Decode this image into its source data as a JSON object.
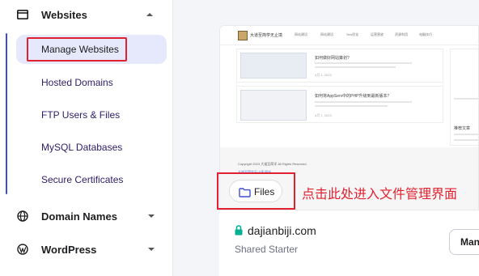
{
  "sidebar": {
    "websites_header": "Websites",
    "items": [
      {
        "label": "Manage Websites"
      },
      {
        "label": "Hosted Domains"
      },
      {
        "label": "FTP Users & Files"
      },
      {
        "label": "MySQL Databases"
      },
      {
        "label": "Secure Certificates"
      }
    ],
    "domain_names": "Domain Names",
    "wordpress": "WordPress"
  },
  "preview": {
    "site_name": "大道至简学无止境",
    "nav": [
      "网站建设",
      "网站建设",
      "Seo优化",
      "运营营收",
      "资源利用",
      "电脑技巧"
    ],
    "posts": [
      {
        "title": "如何做好网站策划?",
        "date": "4月 1, 2023"
      },
      {
        "title": "如何将AppServ中的PHP升级到最新版本？",
        "date": "4月 1, 2023"
      }
    ],
    "sidebar_heading": "推荐文章",
    "copyright": "Copyright 2023 大道至简学 All Rights Reserved.",
    "footer_link": "大道至简学无止境 网站"
  },
  "files_button": {
    "label": "Files"
  },
  "annotation": "点击此处进入文件管理界面",
  "website": {
    "domain": "dajianbiji.com",
    "plan": "Shared Starter",
    "manage_label": "Man"
  },
  "colors": {
    "accent": "#3b4ed6",
    "highlight": "#e0212f",
    "active_bg": "#e6e9fb",
    "lock_green": "#00b090"
  }
}
